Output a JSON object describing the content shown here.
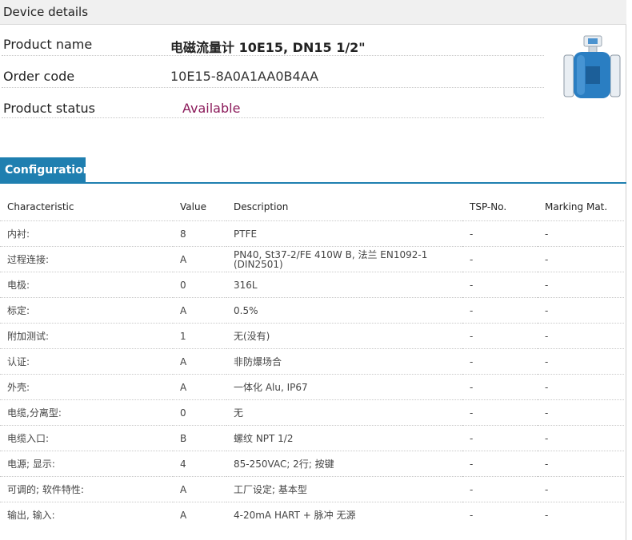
{
  "device_details": {
    "title": "Device details",
    "product_name_label": "Product name",
    "product_name_value": "电磁流量计 10E15, DN15 1/2\"",
    "order_code_label": "Order code",
    "order_code_value": "10E15-8A0A1AA0B4AA",
    "product_status_label": "Product status",
    "product_status_value": "Available"
  },
  "configuration": {
    "tab_label": "Configuration",
    "headers": [
      "Characteristic",
      "Value",
      "Description",
      "TSP-No.",
      "Marking Mat."
    ],
    "rows": [
      {
        "characteristic": "内衬:",
        "value": "8",
        "description": "PTFE",
        "tsp": "-",
        "marking": "-"
      },
      {
        "characteristic": "过程连接:",
        "value": "A",
        "description": "PN40, St37-2/FE 410W B, 法兰 EN1092-1 (DIN2501)",
        "tsp": "-",
        "marking": "-"
      },
      {
        "characteristic": "电极:",
        "value": "0",
        "description": "316L",
        "tsp": "-",
        "marking": "-"
      },
      {
        "characteristic": "标定:",
        "value": "A",
        "description": "0.5%",
        "tsp": "-",
        "marking": "-"
      },
      {
        "characteristic": "附加测试:",
        "value": "1",
        "description": "无(没有)",
        "tsp": "-",
        "marking": "-"
      },
      {
        "characteristic": "认证:",
        "value": "A",
        "description": "非防爆场合",
        "tsp": "-",
        "marking": "-"
      },
      {
        "characteristic": "外壳:",
        "value": "A",
        "description": "一体化 Alu, IP67",
        "tsp": "-",
        "marking": "-"
      },
      {
        "characteristic": "电缆,分离型:",
        "value": "0",
        "description": "无",
        "tsp": "-",
        "marking": "-"
      },
      {
        "characteristic": "电缆入口:",
        "value": "B",
        "description": "螺纹 NPT 1/2",
        "tsp": "-",
        "marking": "-"
      },
      {
        "characteristic": "电源; 显示:",
        "value": "4",
        "description": "85-250VAC; 2行; 按键",
        "tsp": "-",
        "marking": "-"
      },
      {
        "characteristic": "可调的; 软件特性:",
        "value": "A",
        "description": "工厂设定; 基本型",
        "tsp": "-",
        "marking": "-"
      },
      {
        "characteristic": "输出, 输入:",
        "value": "A",
        "description": "4-20mA HART + 脉冲 无源",
        "tsp": "-",
        "marking": "-"
      }
    ]
  },
  "colors": {
    "accent": "#1f7fb0",
    "status": "#8b1a5a",
    "device_body": "#2a7ec2"
  },
  "icons": {
    "device_image": "flowmeter-image"
  }
}
